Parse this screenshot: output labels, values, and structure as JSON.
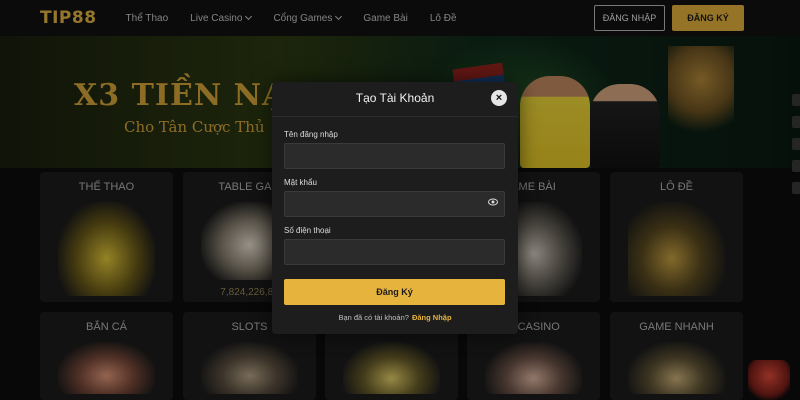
{
  "brand": {
    "logo_text": "TIP88",
    "accent": "#E6B33C"
  },
  "nav": {
    "items": [
      {
        "label": "Thể Thao",
        "has_dropdown": false
      },
      {
        "label": "Live Casino",
        "has_dropdown": true
      },
      {
        "label": "Cổng Games",
        "has_dropdown": true
      },
      {
        "label": "Game Bài",
        "has_dropdown": false
      },
      {
        "label": "Lô Đề",
        "has_dropdown": false
      }
    ],
    "login_label": "ĐĂNG NHẬP",
    "register_label": "ĐĂNG KÝ"
  },
  "banner": {
    "title": "X3 TIỀN NẠ",
    "subtitle": "Cho Tân Cược Thủ"
  },
  "categories": [
    {
      "label": "THỂ THAO"
    },
    {
      "label": "TABLE GAM"
    },
    {
      "label": "AME BÀI"
    },
    {
      "label": "LÔ ĐỀ"
    },
    {
      "label": "BẮN CÁ"
    },
    {
      "label": "SLOTS"
    },
    {
      "label": "E CASINO"
    },
    {
      "label": "GAME NHANH"
    }
  ],
  "table_game_stat": "7,824,226,89",
  "modal": {
    "title": "Tạo Tài Khoản",
    "close_icon": "close-icon",
    "fields": [
      {
        "label": "Tên đăng nhập",
        "value": ""
      },
      {
        "label": "Mật khẩu",
        "value": ""
      },
      {
        "label": "Số điện thoại",
        "value": ""
      }
    ],
    "submit_label": "Đăng Ký",
    "footer_text": "Bạn đã có tài khoản?",
    "footer_link": "Đăng Nhập"
  }
}
